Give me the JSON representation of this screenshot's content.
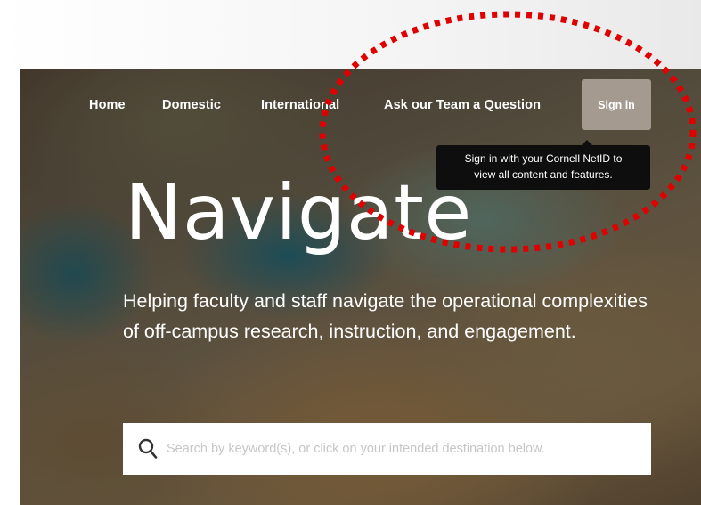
{
  "nav": {
    "items": [
      {
        "label": "Home"
      },
      {
        "label": "Domestic"
      },
      {
        "label": "International"
      },
      {
        "label": "Ask our Team a Question"
      }
    ],
    "signin_label": "Sign in"
  },
  "tooltip": {
    "line1": "Sign in with your Cornell NetID to",
    "line2": "view all content and features."
  },
  "hero": {
    "title": "Navigate",
    "subtitle": "Helping faculty and staff navigate the operational complexities of off-campus research, instruction, and engagement."
  },
  "search": {
    "placeholder": "Search by keyword(s), or click on your intended destination below.",
    "value": ""
  },
  "colors": {
    "signin_bg": "#a59a90",
    "annotation": "#e00000",
    "tooltip_bg": "#0e0e0e"
  }
}
